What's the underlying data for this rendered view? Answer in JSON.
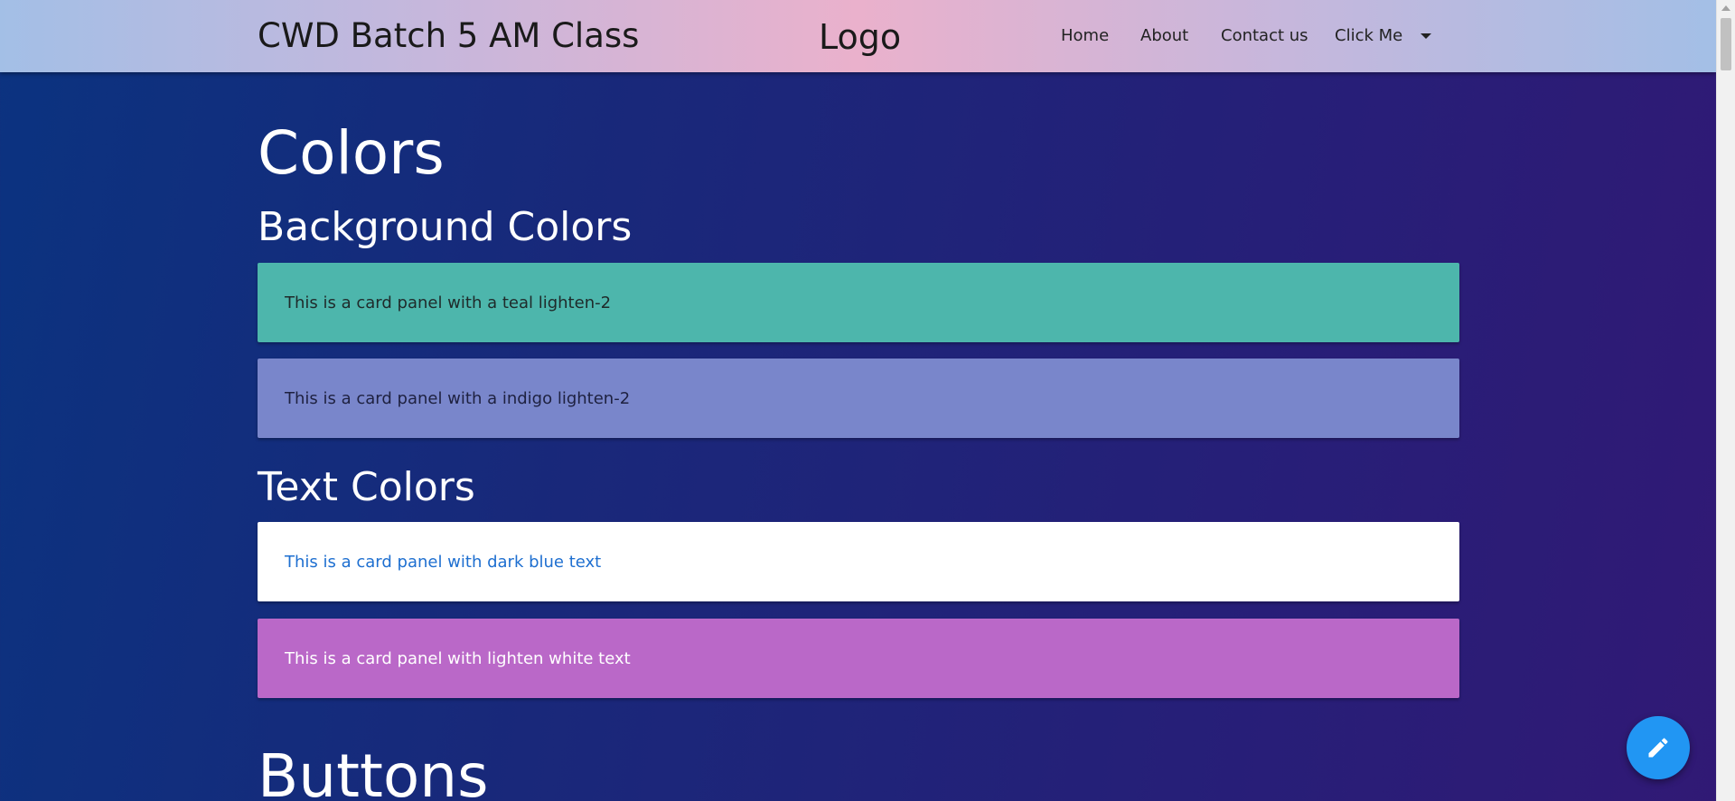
{
  "navbar": {
    "brand": "CWD Batch 5 AM Class",
    "logo": "Logo",
    "items": [
      {
        "label": "Home"
      },
      {
        "label": "About"
      },
      {
        "label": "Contact us"
      },
      {
        "label": "Click Me"
      }
    ],
    "dropdown_icon": "caret-down-icon"
  },
  "main": {
    "title": "Colors",
    "background_section": {
      "heading": "Background Colors",
      "cards": [
        {
          "text": "This is a card panel with a teal lighten-2",
          "bg": "#4db6ac",
          "color": "#1f2a2a"
        },
        {
          "text": "This is a card panel with a indigo lighten-2",
          "bg": "#7986cb",
          "color": "#1e2140"
        }
      ]
    },
    "text_section": {
      "heading": "Text Colors",
      "cards": [
        {
          "text": "This is a card panel with dark blue text",
          "bg": "#ffffff",
          "color": "#1e6fd0"
        },
        {
          "text": "This is a card panel with lighten white text",
          "bg": "#ba68c8",
          "color": "#ffffff"
        }
      ]
    },
    "buttons_heading": "Buttons"
  },
  "fab": {
    "icon": "pencil-edit-icon",
    "color": "#2196f3"
  },
  "theme": {
    "accent": "#2196f3",
    "header_gradient": [
      "#a3bfe6",
      "#eab1cc"
    ],
    "page_gradient": [
      "#0b3380",
      "#311975"
    ]
  }
}
